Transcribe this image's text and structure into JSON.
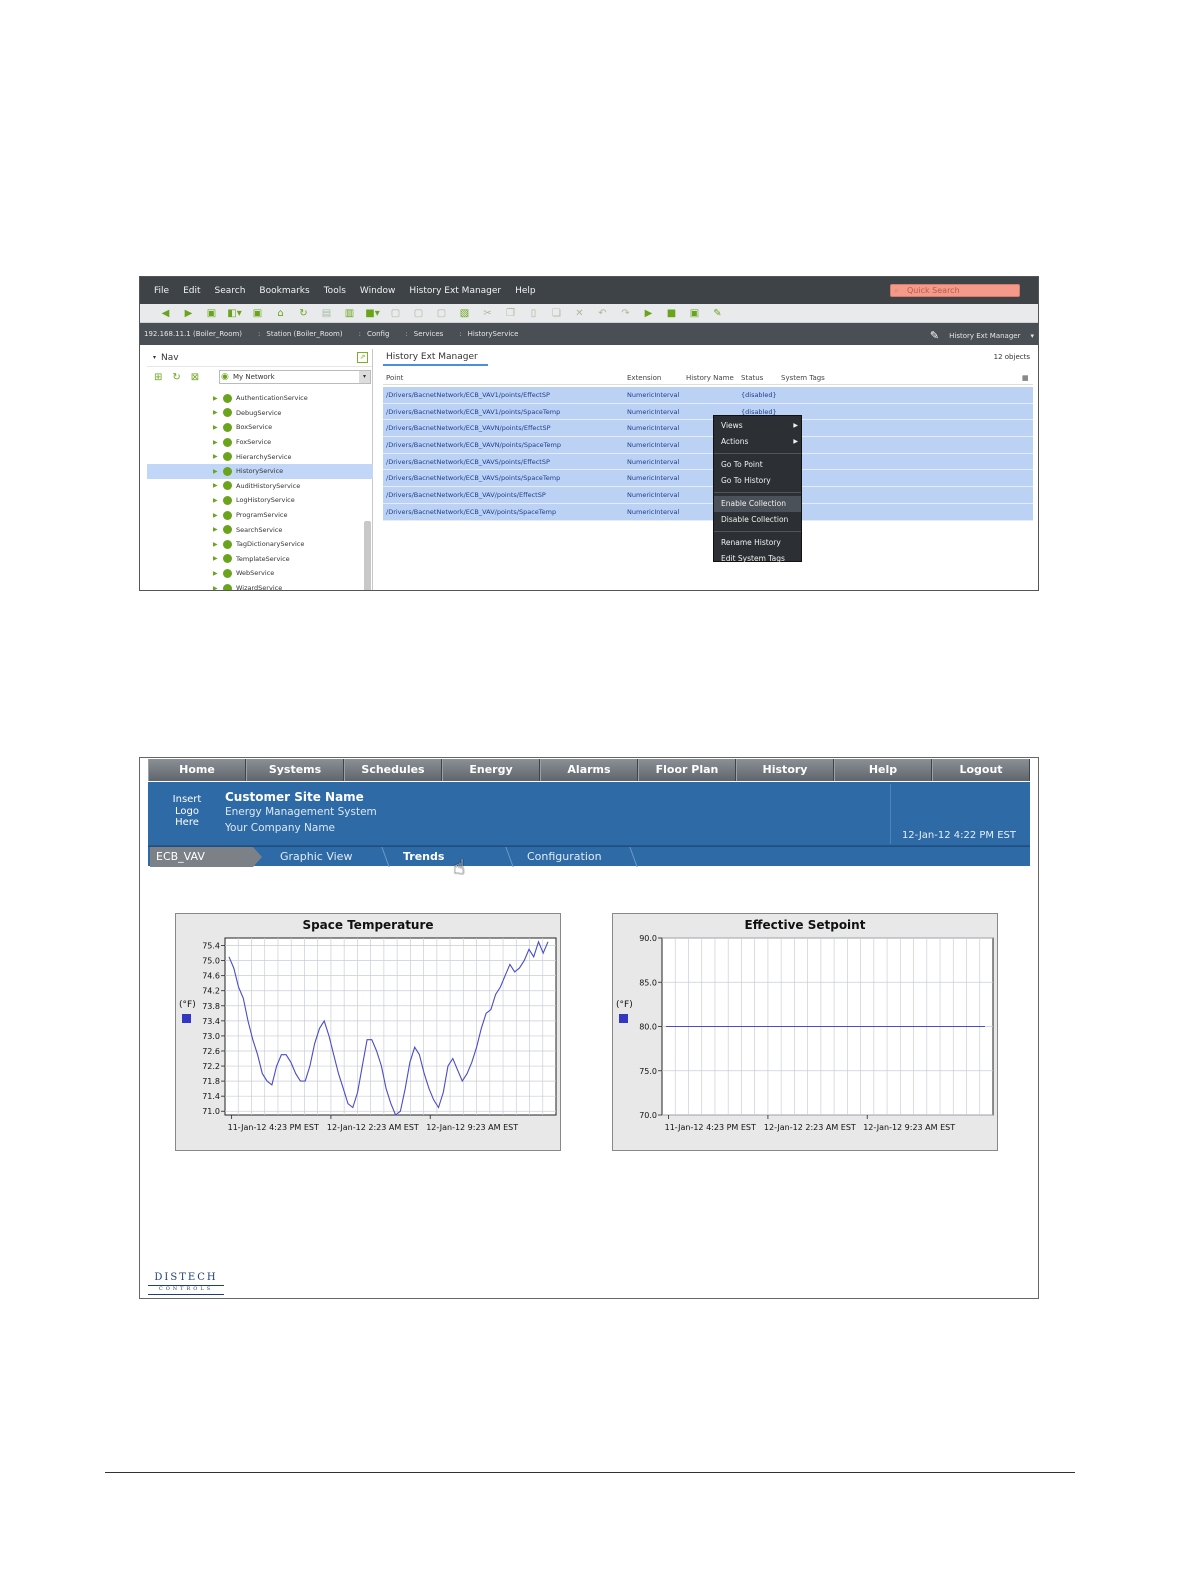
{
  "workbench": {
    "menu": [
      "File",
      "Edit",
      "Search",
      "Bookmarks",
      "Tools",
      "Window",
      "History Ext Manager",
      "Help"
    ],
    "quick_search_placeholder": "Quick Search",
    "breadcrumbs": [
      "192.168.11.1 (Boiler_Room)",
      "Station (Boiler_Room)",
      "Config",
      "Services",
      "HistoryService"
    ],
    "view_selector": "History Ext Manager",
    "nav": {
      "title": "Nav",
      "network": "My Network",
      "items": [
        {
          "label": "AuthenticationService",
          "selected": false
        },
        {
          "label": "DebugService",
          "selected": false
        },
        {
          "label": "BoxService",
          "selected": false
        },
        {
          "label": "FoxService",
          "selected": false
        },
        {
          "label": "HierarchyService",
          "selected": false
        },
        {
          "label": "HistoryService",
          "selected": true
        },
        {
          "label": "AuditHistoryService",
          "selected": false
        },
        {
          "label": "LogHistoryService",
          "selected": false
        },
        {
          "label": "ProgramService",
          "selected": false
        },
        {
          "label": "SearchService",
          "selected": false
        },
        {
          "label": "TagDictionaryService",
          "selected": false
        },
        {
          "label": "TemplateService",
          "selected": false
        },
        {
          "label": "WebService",
          "selected": false
        },
        {
          "label": "WizardService",
          "selected": false
        }
      ]
    },
    "main": {
      "tab": "History Ext Manager",
      "count": "12 objects",
      "columns": [
        "Point",
        "Extension",
        "History Name",
        "Status",
        "System Tags"
      ],
      "rows": [
        {
          "point": "/Drivers/BacnetNetwork/ECB_VAV1/points/EffectSP",
          "extension": "NumericInterval",
          "status": "{disabled}"
        },
        {
          "point": "/Drivers/BacnetNetwork/ECB_VAV1/points/SpaceTemp",
          "extension": "NumericInterval",
          "status": "{disabled}"
        },
        {
          "point": "/Drivers/BacnetNetwork/ECB_VAVN/points/EffectSP",
          "extension": "NumericInterval",
          "status": ""
        },
        {
          "point": "/Drivers/BacnetNetwork/ECB_VAVN/points/SpaceTemp",
          "extension": "NumericInterval",
          "status": ""
        },
        {
          "point": "/Drivers/BacnetNetwork/ECB_VAVS/points/EffectSP",
          "extension": "NumericInterval",
          "status": ""
        },
        {
          "point": "/Drivers/BacnetNetwork/ECB_VAVS/points/SpaceTemp",
          "extension": "NumericInterval",
          "status": ""
        },
        {
          "point": "/Drivers/BacnetNetwork/ECB_VAV/points/EffectSP",
          "extension": "NumericInterval",
          "status": ""
        },
        {
          "point": "/Drivers/BacnetNetwork/ECB_VAV/points/SpaceTemp",
          "extension": "NumericInterval",
          "status": ""
        }
      ]
    },
    "context_menu": {
      "views": "Views",
      "actions": "Actions",
      "go_to_point": "Go To Point",
      "go_to_history": "Go To History",
      "enable_collection": "Enable Collection",
      "disable_collection": "Disable Collection",
      "rename_history": "Rename History",
      "edit_system_tags": "Edit System Tags"
    }
  },
  "webui": {
    "tabs": [
      "Home",
      "Systems",
      "Schedules",
      "Energy",
      "Alarms",
      "Floor Plan",
      "History",
      "Help",
      "Logout"
    ],
    "logo_placeholder": [
      "Insert",
      "Logo",
      "Here"
    ],
    "site_name": "Customer Site Name",
    "system_name": "Energy Management System",
    "company_name": "Your Company Name",
    "datetime": "12-Jan-12 4:22 PM EST",
    "subnav": {
      "device": "ECB_VAV",
      "graphic": "Graphic View",
      "trends": "Trends",
      "config": "Configuration"
    },
    "logo_brand": "DISTECH",
    "logo_sub": "CONTROLS"
  },
  "chart_data": [
    {
      "type": "line",
      "title": "Space Temperature",
      "ylabel": "(°F)",
      "ylim": [
        70.9,
        75.6
      ],
      "yticks": [
        "75.4",
        "75.0",
        "74.6",
        "74.2",
        "73.8",
        "73.4",
        "73.0",
        "72.6",
        "72.2",
        "71.8",
        "71.4",
        "71.0"
      ],
      "xticks": [
        "11-Jan-12 4:23 PM EST",
        "12-Jan-12 2:23 AM EST",
        "12-Jan-12 9:23 AM EST"
      ],
      "color": "#4a4cc8",
      "series": [
        {
          "values": [
            75.1,
            74.8,
            74.3,
            74.0,
            73.4,
            72.9,
            72.5,
            72.0,
            71.8,
            71.7,
            72.2,
            72.5,
            72.5,
            72.3,
            72.0,
            71.8,
            71.8,
            72.2,
            72.8,
            73.2,
            73.4,
            73.0,
            72.5,
            72.0,
            71.6,
            71.2,
            71.1,
            71.5,
            72.2,
            72.9,
            72.9,
            72.6,
            72.2,
            71.6,
            71.2,
            70.9,
            71.0,
            71.6,
            72.3,
            72.7,
            72.5,
            72.0,
            71.6,
            71.3,
            71.1,
            71.5,
            72.2,
            72.4,
            72.1,
            71.8,
            72.0,
            72.3,
            72.7,
            73.2,
            73.6,
            73.7,
            74.1,
            74.3,
            74.6,
            74.9,
            74.7,
            74.8,
            75.0,
            75.3,
            75.1,
            75.5,
            75.2,
            75.5
          ]
        }
      ]
    },
    {
      "type": "line",
      "title": "Effective Setpoint",
      "ylabel": "(°F)",
      "ylim": [
        70.0,
        90.0
      ],
      "yticks": [
        "90.0",
        "85.0",
        "80.0",
        "75.0",
        "70.0"
      ],
      "xticks": [
        "11-Jan-12 4:23 PM EST",
        "12-Jan-12 2:23 AM EST",
        "12-Jan-12 9:23 AM EST"
      ],
      "color": "#4a4cc8",
      "series": [
        {
          "values": [
            80.0,
            80.0
          ]
        }
      ]
    }
  ]
}
